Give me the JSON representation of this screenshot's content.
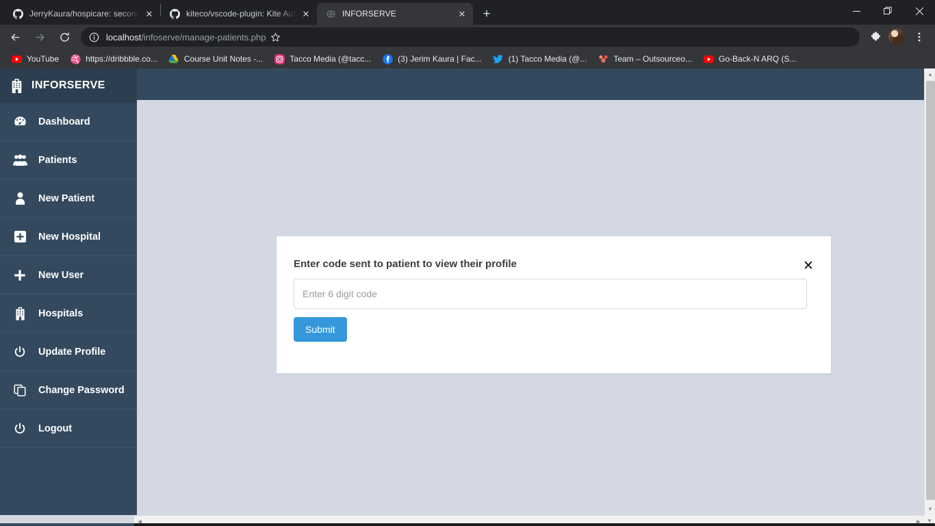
{
  "browser": {
    "tabs": [
      {
        "title": "JerryKaura/hospicare: second yea",
        "favicon": "github-icon",
        "active": false
      },
      {
        "title": "kiteco/vscode-plugin: Kite Autoc",
        "favicon": "github-icon",
        "active": false
      },
      {
        "title": "INFORSERVE",
        "favicon": "globe-icon",
        "active": true
      }
    ],
    "new_tab_label": "+",
    "window_controls": {
      "minimize": "minimize-icon",
      "maximize": "restore-icon",
      "close": "close-icon"
    },
    "toolbar": {
      "back": "back-arrow-icon",
      "forward": "forward-arrow-icon",
      "reload": "reload-icon",
      "site_info": "info-circle-icon",
      "url_host": "localhost",
      "url_path": "/infoserve/manage-patients.php",
      "bookmark_star": "star-icon",
      "extensions": "puzzle-icon",
      "profile": "avatar",
      "menu": "three-dot-menu-icon"
    },
    "bookmarks": [
      {
        "label": "YouTube",
        "icon": "youtube-icon"
      },
      {
        "label": "https://dribbble.co...",
        "icon": "dribbble-icon"
      },
      {
        "label": "Course Unit Notes -...",
        "icon": "google-drive-icon"
      },
      {
        "label": "Tacco Media (@tacc...",
        "icon": "instagram-icon"
      },
      {
        "label": "(3) Jerim Kaura | Fac...",
        "icon": "facebook-icon"
      },
      {
        "label": "(1) Tacco Media (@...",
        "icon": "twitter-icon"
      },
      {
        "label": "Team – Outsourceo...",
        "icon": "asana-icon"
      },
      {
        "label": "Go-Back-N ARQ (S...",
        "icon": "youtube-icon"
      }
    ]
  },
  "app": {
    "brand": {
      "label": "INFORSERVE",
      "icon": "hospital-icon"
    },
    "sidebar": {
      "items": [
        {
          "label": "Dashboard",
          "icon": "dashboard-gauge-icon"
        },
        {
          "label": "Patients",
          "icon": "users-icon"
        },
        {
          "label": "New Patient",
          "icon": "user-icon"
        },
        {
          "label": "New Hospital",
          "icon": "plus-square-icon"
        },
        {
          "label": "New User",
          "icon": "plus-icon"
        },
        {
          "label": "Hospitals",
          "icon": "hospital-icon"
        },
        {
          "label": "Update Profile",
          "icon": "power-icon"
        },
        {
          "label": "Change Password",
          "icon": "copy-icon"
        },
        {
          "label": "Logout",
          "icon": "power-icon"
        }
      ]
    },
    "modal": {
      "title": "Enter code sent to patient to view their profile",
      "close_icon": "close-icon",
      "code_placeholder": "Enter 6 digit code",
      "code_value": "",
      "submit_label": "Submit"
    }
  },
  "colors": {
    "sidebar": "#34495e",
    "sidebar_brand": "#2c3e50",
    "content_bg": "#d3d8e3",
    "accent_button": "#3498db",
    "modal_bg": "#ffffff"
  }
}
